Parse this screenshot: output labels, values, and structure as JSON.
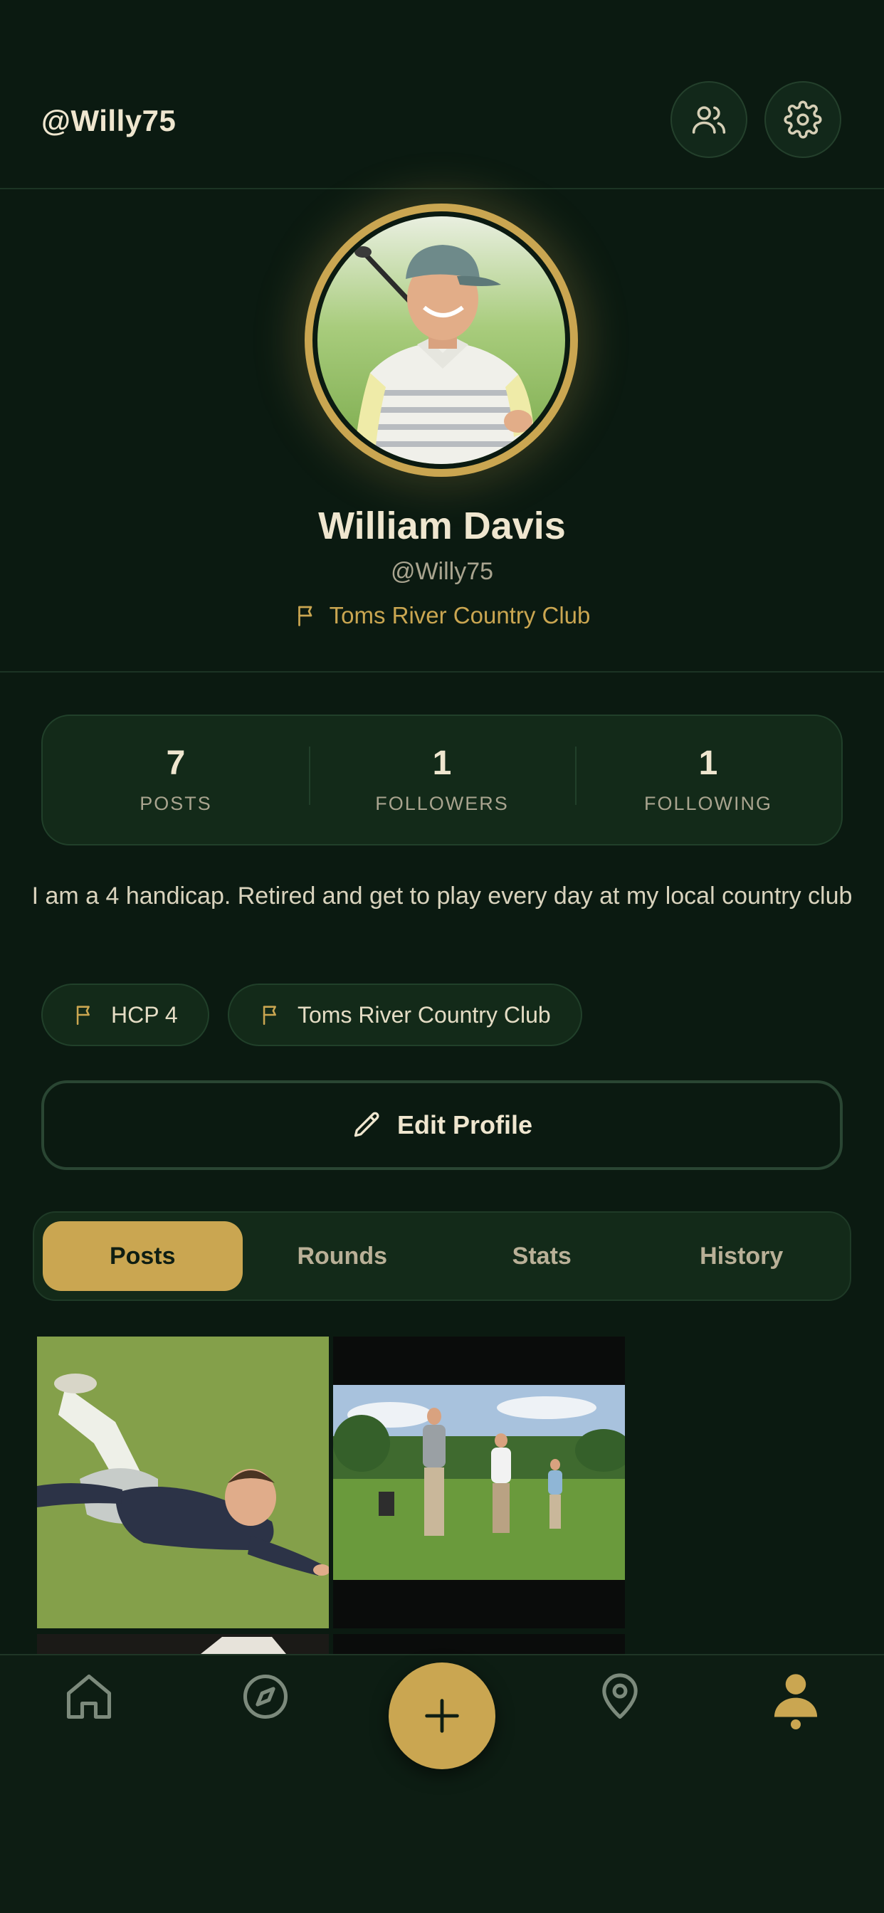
{
  "header": {
    "handle": "@Willy75",
    "icons": [
      "friends-icon",
      "gear-icon"
    ]
  },
  "profile": {
    "name": "William Davis",
    "handle": "@Willy75",
    "club": "Toms River Country Club"
  },
  "stats": [
    {
      "value": "7",
      "label": "POSTS"
    },
    {
      "value": "1",
      "label": "FOLLOWERS"
    },
    {
      "value": "1",
      "label": "FOLLOWING"
    }
  ],
  "bio": "I am a 4 handicap. Retired and get to play every day at my local country club",
  "chips": [
    {
      "label": "HCP 4",
      "icon": "flag-icon"
    },
    {
      "label": "Toms River Country Club",
      "icon": "flag-icon"
    }
  ],
  "edit_button": {
    "label": "Edit Profile",
    "icon": "pencil-icon"
  },
  "tabs": [
    {
      "label": "Posts",
      "active": true
    },
    {
      "label": "Rounds",
      "active": false
    },
    {
      "label": "Stats",
      "active": false
    },
    {
      "label": "History",
      "active": false
    }
  ],
  "posts": [
    {
      "image": "golfer-lying-on-grass"
    },
    {
      "image": "three-golfers-on-course"
    }
  ],
  "bottom_nav": {
    "items": [
      "home-icon",
      "compass-icon",
      "add-icon",
      "location-pin-icon",
      "profile-icon"
    ],
    "active": "profile-icon"
  },
  "colors": {
    "background": "#0b1a11",
    "card": "#132a19",
    "accent": "#caa651",
    "text": "#efe6cf",
    "muted": "#a9a48f"
  }
}
